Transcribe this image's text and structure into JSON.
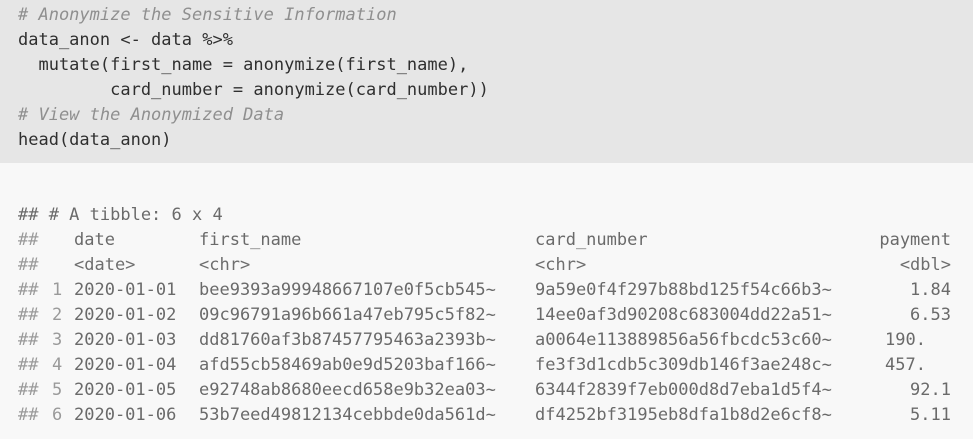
{
  "code": {
    "lines": [
      {
        "text": "# Anonymize the Sensitive Information",
        "kind": "comment"
      },
      {
        "text": "data_anon <- data %>%",
        "kind": "code"
      },
      {
        "text": "  mutate(first_name = anonymize(first_name),",
        "kind": "code"
      },
      {
        "text": "         card_number = anonymize(card_number))",
        "kind": "code"
      },
      {
        "text": "# View the Anonymized Data",
        "kind": "comment"
      },
      {
        "text": "head(data_anon)",
        "kind": "code"
      }
    ]
  },
  "output": {
    "summary": "## # A tibble: 6 x 4",
    "prefix": "##",
    "columns": [
      {
        "name": "date",
        "type": "<date>"
      },
      {
        "name": "first_name",
        "type": "<chr>"
      },
      {
        "name": "card_number",
        "type": "<chr>"
      },
      {
        "name": "payment",
        "type": "<dbl>"
      }
    ],
    "rows": [
      {
        "idx": "1",
        "date": "2020-01-01",
        "first_name": "bee9393a99948667107e0f5cb545~",
        "card_number": "9a59e0f4f297b88bd125f54c66b3~",
        "payment": "1.84"
      },
      {
        "idx": "2",
        "date": "2020-01-02",
        "first_name": "09c96791a96b661a47eb795c5f82~",
        "card_number": "14ee0af3d90208c683004dd22a51~",
        "payment": "6.53"
      },
      {
        "idx": "3",
        "date": "2020-01-03",
        "first_name": "dd81760af3b87457795463a2393b~",
        "card_number": "a0064e113889856a56fbcdc53c60~",
        "payment": "190."
      },
      {
        "idx": "4",
        "date": "2020-01-04",
        "first_name": "afd55cb58469ab0e9d5203baf166~",
        "card_number": "fe3f3d1cdb5c309db146f3ae248c~",
        "payment": "457."
      },
      {
        "idx": "5",
        "date": "2020-01-05",
        "first_name": "e92748ab8680eecd658e9b32ea03~",
        "card_number": "6344f2839f7eb000d8d7eba1d5f4~",
        "payment": "92.1"
      },
      {
        "idx": "6",
        "date": "2020-01-06",
        "first_name": "53b7eed49812134cebbde0da561d~",
        "card_number": "df4252bf3195eb8dfa1b8d2e6cf8~",
        "payment": "5.11"
      }
    ]
  }
}
